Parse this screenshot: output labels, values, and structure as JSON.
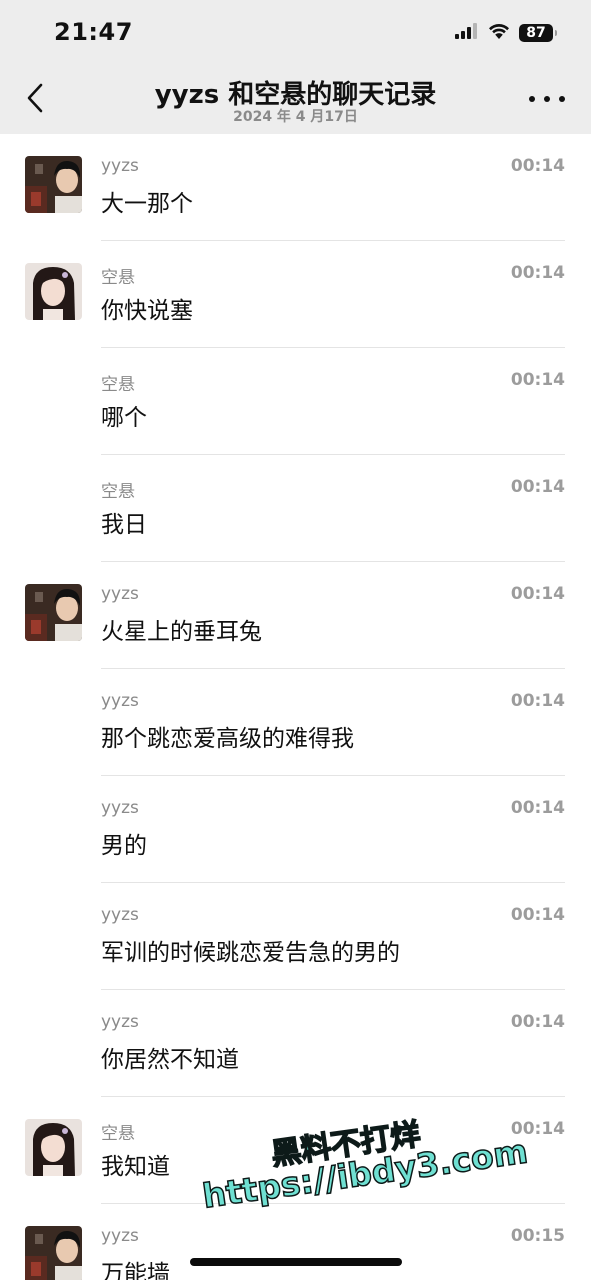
{
  "status_bar": {
    "time": "21:47",
    "battery": "87"
  },
  "header": {
    "title": "yyzs 和空悬的聊天记录",
    "date": "2024 年 4 月17日"
  },
  "messages": [
    {
      "sender": "yyzs",
      "time": "00:14",
      "text": "大一那个",
      "avatar": "male"
    },
    {
      "sender": "空悬",
      "time": "00:14",
      "text": "你快说塞",
      "avatar": "female"
    },
    {
      "sender": "空悬",
      "time": "00:14",
      "text": "哪个",
      "avatar": null
    },
    {
      "sender": "空悬",
      "time": "00:14",
      "text": "我日",
      "avatar": null
    },
    {
      "sender": "yyzs",
      "time": "00:14",
      "text": "火星上的垂耳兔",
      "avatar": "male"
    },
    {
      "sender": "yyzs",
      "time": "00:14",
      "text": "那个跳恋爱高级的难得我",
      "avatar": null
    },
    {
      "sender": "yyzs",
      "time": "00:14",
      "text": "男的",
      "avatar": null
    },
    {
      "sender": "yyzs",
      "time": "00:14",
      "text": "军训的时候跳恋爱告急的男的",
      "avatar": null
    },
    {
      "sender": "yyzs",
      "time": "00:14",
      "text": "你居然不知道",
      "avatar": null
    },
    {
      "sender": "空悬",
      "time": "00:14",
      "text": "我知道",
      "avatar": "female"
    },
    {
      "sender": "yyzs",
      "time": "00:15",
      "text": "万能墙",
      "avatar": "male"
    }
  ],
  "watermark": {
    "line1": "黑料不打烊",
    "line2": "https://ibdy3.com"
  },
  "icons": {
    "back": "chevron-left-icon",
    "more": "more-dots-icon",
    "signal": "cellular-signal-icon",
    "wifi": "wifi-icon",
    "battery": "battery-icon"
  },
  "colors": {
    "header_bg": "#ededed",
    "watermark": "#6fe0d2"
  }
}
